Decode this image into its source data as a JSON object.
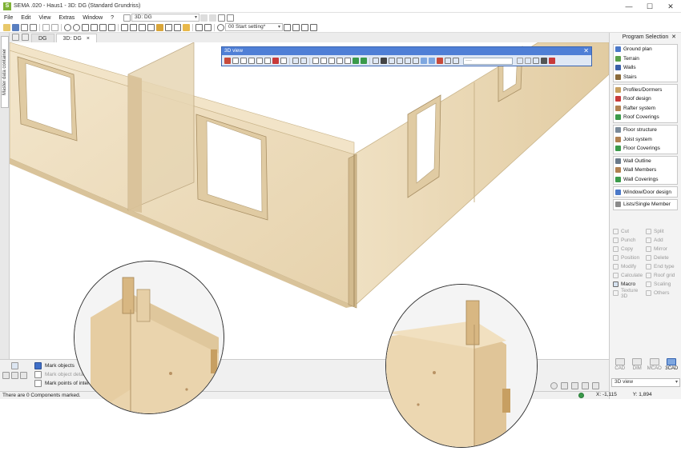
{
  "window": {
    "title": "SEMA .020 - Haus1 - 3D: DG (Standard Grundriss)",
    "logo": "S",
    "min": "—",
    "max": "☐",
    "close": "✕"
  },
  "menu": [
    "File",
    "Edit",
    "View",
    "Extras",
    "Window",
    "?"
  ],
  "view_combo": "3D: DG",
  "settings_combo": "00 Start setting*",
  "doc_tabs": [
    {
      "label": "DG",
      "active": false
    },
    {
      "label": "3D: DG",
      "active": true
    }
  ],
  "doc_tab_close": "×",
  "left_tab": "Master data container",
  "view3d": {
    "title": "3D view",
    "close": "✕",
    "field": "····"
  },
  "program_selection": {
    "title": "Program Selection",
    "close": "✕",
    "groups": [
      [
        {
          "label": "Ground plan",
          "icon": "ground-plan-icon",
          "color": "#4a78c8"
        },
        {
          "label": "Terrain",
          "icon": "terrain-icon",
          "color": "#5aa04a"
        },
        {
          "label": "Walls",
          "icon": "walls-icon",
          "color": "#3a5fa8"
        },
        {
          "label": "Stairs",
          "icon": "stairs-icon",
          "color": "#8a6a3a"
        }
      ],
      [
        {
          "label": "Profiles/Dormers",
          "icon": "dormers-icon",
          "color": "#c8a060"
        },
        {
          "label": "Roof design",
          "icon": "roof-design-icon",
          "color": "#c83a3a"
        },
        {
          "label": "Rafter system",
          "icon": "rafter-icon",
          "color": "#b08050"
        },
        {
          "label": "Roof Coverings",
          "icon": "roof-coverings-icon",
          "color": "#3a9a4a"
        }
      ],
      [
        {
          "label": "Floor structure",
          "icon": "floor-structure-icon",
          "color": "#7a8a9a"
        },
        {
          "label": "Joist system",
          "icon": "joist-icon",
          "color": "#b08050"
        },
        {
          "label": "Floor Coverings",
          "icon": "floor-coverings-icon",
          "color": "#3a9a4a"
        }
      ],
      [
        {
          "label": "Wall Outline",
          "icon": "wall-outline-icon",
          "color": "#6a7a8a"
        },
        {
          "label": "Wall Members",
          "icon": "wall-members-icon",
          "color": "#b08050"
        },
        {
          "label": "Wall Coverings",
          "icon": "wall-coverings-icon",
          "color": "#3a9a4a"
        }
      ],
      [
        {
          "label": "Window/Door design",
          "icon": "window-door-icon",
          "color": "#4a78c8"
        }
      ],
      [
        {
          "label": "Lists/Single Member",
          "icon": "lists-icon",
          "color": "#8a8a8a"
        }
      ]
    ]
  },
  "edit_tools": [
    {
      "label": "Cut",
      "enabled": false,
      "icon": "cut-icon"
    },
    {
      "label": "Split",
      "enabled": false,
      "icon": "split-icon"
    },
    {
      "label": "Punch",
      "enabled": false,
      "icon": "punch-icon"
    },
    {
      "label": "Add",
      "enabled": false,
      "icon": "add-icon"
    },
    {
      "label": "Copy",
      "enabled": false,
      "icon": "copy-icon"
    },
    {
      "label": "Mirror",
      "enabled": false,
      "icon": "mirror-icon"
    },
    {
      "label": "Position",
      "enabled": false,
      "icon": "position-icon"
    },
    {
      "label": "Delete",
      "enabled": false,
      "icon": "delete-icon"
    },
    {
      "label": "Modify",
      "enabled": false,
      "icon": "modify-icon"
    },
    {
      "label": "End type",
      "enabled": false,
      "icon": "end-type-icon"
    },
    {
      "label": "Calculate",
      "enabled": false,
      "icon": "calculate-icon"
    },
    {
      "label": "Roof grid",
      "enabled": false,
      "icon": "roof-grid-icon"
    },
    {
      "label": "Macro",
      "enabled": true,
      "icon": "macro-icon"
    },
    {
      "label": "Scaling",
      "enabled": false,
      "icon": "scaling-icon"
    },
    {
      "label": "Texture 3D",
      "enabled": false,
      "icon": "texture-icon"
    },
    {
      "label": "Others",
      "enabled": false,
      "icon": "others-icon"
    }
  ],
  "modes": [
    {
      "label": "CAD",
      "active": false
    },
    {
      "label": "DIM",
      "active": false
    },
    {
      "label": "MCAO",
      "active": false
    },
    {
      "label": "3CAD",
      "active": true
    }
  ],
  "mode_combo": "3D view",
  "marks": [
    {
      "label": "Mark objects",
      "selected": true
    },
    {
      "label": "Mark object details",
      "selected": false
    },
    {
      "label": "Mark points of interest",
      "selected": false
    }
  ],
  "status": {
    "message": "There are 0 Components marked.",
    "x_label": "X: -1,115",
    "y_label": "Y: 1,894"
  },
  "colors": {
    "wood": "#eddcbc",
    "wood_dark": "#dcc7a0",
    "selection_blue": "#4f7fd6",
    "accent_green": "#7fb236"
  }
}
